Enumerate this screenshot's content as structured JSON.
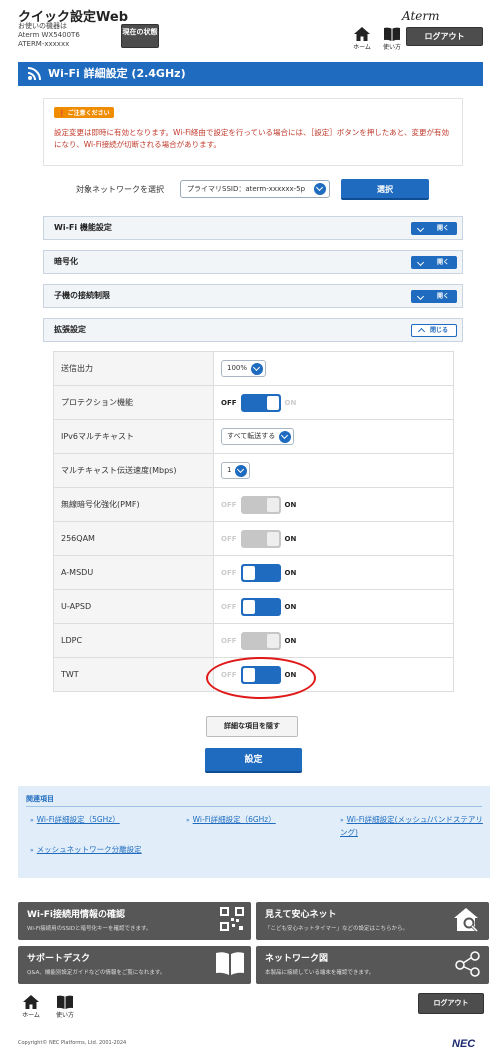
{
  "header": {
    "app_title": "クイック設定Web",
    "device_label": "お使いの機器は",
    "device_model": "Aterm WX5400T6",
    "device_name": "ATERM-xxxxxx",
    "status_button": "現在の状態",
    "brand": "Aterm",
    "nav_home": "ホーム",
    "nav_usage": "使い方",
    "logout": "ログアウト"
  },
  "section": {
    "title": "Wi-Fi 詳細設定 (2.4GHz)"
  },
  "notice": {
    "badge": "ご注意ください",
    "text": "設定変更は即時に有効となります。Wi-Fi経由で設定を行っている場合には、［設定］ボタンを押したあと、変更が有効になり、Wi-Fi接続が切断される場合があります。"
  },
  "network_select": {
    "label": "対象ネットワークを選択",
    "value": "プライマリSSID：aterm-xxxxxx-5p",
    "button": "選択"
  },
  "accordions": [
    {
      "label": "Wi-Fi 機能設定",
      "button": "開く"
    },
    {
      "label": "暗号化",
      "button": "開く"
    },
    {
      "label": "子機の接続制限",
      "button": "開く"
    },
    {
      "label": "拡張設定",
      "button": "閉じる"
    }
  ],
  "settings": {
    "tx_power": {
      "label": "送信出力",
      "value": "100%"
    },
    "protection": {
      "label": "プロテクション機能",
      "off": "OFF",
      "on": "ON",
      "state": "off"
    },
    "ipv6_multicast": {
      "label": "IPv6マルチキャスト",
      "value": "すべて転送する"
    },
    "multicast_rate": {
      "label": "マルチキャスト伝送速度(Mbps)",
      "value": "1"
    },
    "pmf": {
      "label": "無線暗号化強化(PMF)",
      "off": "OFF",
      "on": "ON",
      "state": "on-disabled"
    },
    "qam256": {
      "label": "256QAM",
      "off": "OFF",
      "on": "ON",
      "state": "on-disabled"
    },
    "amsdu": {
      "label": "A-MSDU",
      "off": "OFF",
      "on": "ON",
      "state": "on"
    },
    "uapsd": {
      "label": "U-APSD",
      "off": "OFF",
      "on": "ON",
      "state": "on"
    },
    "ldpc": {
      "label": "LDPC",
      "off": "OFF",
      "on": "ON",
      "state": "on-disabled"
    },
    "twt": {
      "label": "TWT",
      "off": "OFF",
      "on": "ON",
      "state": "on"
    }
  },
  "actions": {
    "hide_details": "詳細な項目を隠す",
    "apply": "設定"
  },
  "related": {
    "heading": "関連項目",
    "links": [
      "Wi-Fi詳細設定（5GHz）",
      "Wi-Fi詳細設定（6GHz）",
      "Wi-Fi詳細設定(メッシュ/バンドステアリング)",
      "メッシュネットワーク分離設定"
    ]
  },
  "tiles": [
    {
      "title": "Wi-Fi接続用情報の確認",
      "sub": "Wi-Fi接続用のSSIDと暗号化キーを確認できます。",
      "icon": "qr-code-icon"
    },
    {
      "title": "見えて安心ネット",
      "sub": "「こども安心ネットタイマー」などの設定はこちらから。",
      "icon": "house-search-icon"
    },
    {
      "title": "サポートデスク",
      "sub": "Q&A、機能別設定ガイドなどの情報をご覧になれます。",
      "icon": "book-icon"
    },
    {
      "title": "ネットワーク図",
      "sub": "本製品に接続している端末を確認できます。",
      "icon": "network-icon"
    }
  ],
  "footer": {
    "copyright": "Copyright© NEC Platforms, Ltd. 2001-2024",
    "logo": "NEC"
  },
  "colors": {
    "primary": "#1e6bbf",
    "dark_button": "#4d4d4d",
    "notice_text": "#c0392b",
    "highlight": "#e01818"
  }
}
